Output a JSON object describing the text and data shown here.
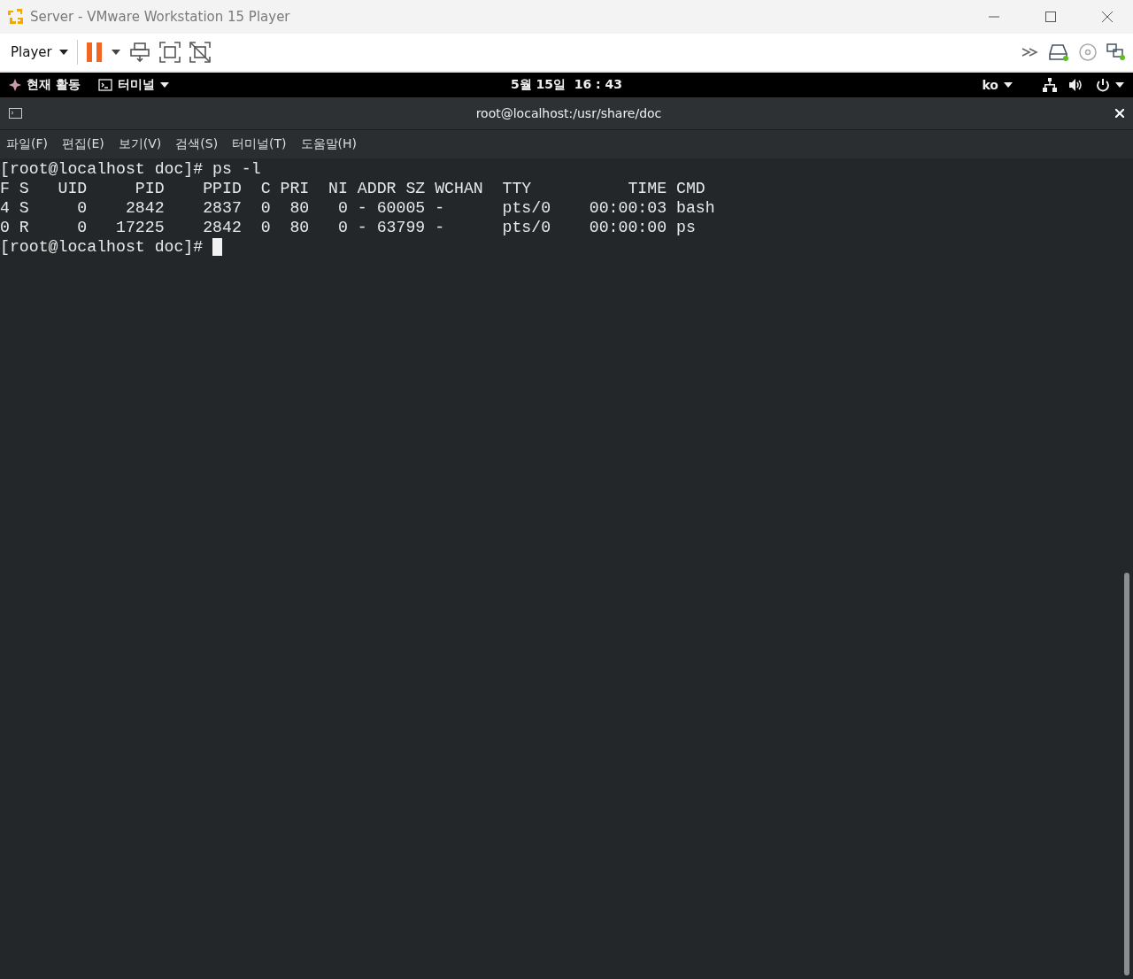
{
  "window": {
    "title": "Server - VMware Workstation 15 Player"
  },
  "toolbar": {
    "player_menu": "Player"
  },
  "top_bar": {
    "activities": "현재 활동",
    "app_menu": "터미널",
    "clock": "5월 15일  16 : 43",
    "input_method": "ko"
  },
  "terminal": {
    "title": "root@localhost:/usr/share/doc",
    "menu": [
      "파일(F)",
      "편집(E)",
      "보기(V)",
      "검색(S)",
      "터미널(T)",
      "도움말(H)"
    ],
    "lines": [
      "[root@localhost doc]# ps -l",
      "F S   UID     PID    PPID  C PRI  NI ADDR SZ WCHAN  TTY          TIME CMD",
      "4 S     0    2842    2837  0  80   0 - 60005 -      pts/0    00:00:03 bash",
      "0 R     0   17225    2842  0  80   0 - 63799 -      pts/0    00:00:00 ps"
    ],
    "prompt": "[root@localhost doc]# "
  }
}
